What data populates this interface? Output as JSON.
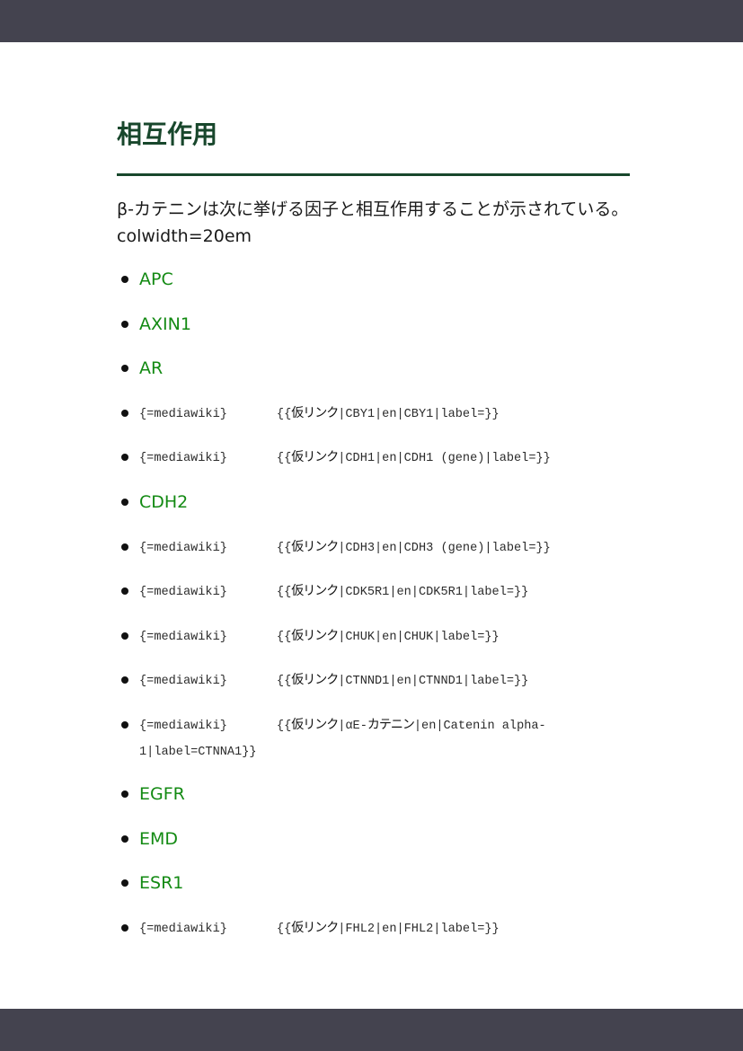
{
  "section": {
    "title": "相互作用",
    "intro": "β-カテニンは次に挙げる因子と相互作用することが示されている。colwidth=20em"
  },
  "interactors": [
    {
      "kind": "link",
      "text": "APC"
    },
    {
      "kind": "link",
      "text": "AXIN1"
    },
    {
      "kind": "link",
      "text": "AR"
    },
    {
      "kind": "code",
      "prefix": "{=mediawiki}",
      "open": "{{",
      "template": "仮リンク",
      "args": "|CBY1|en|CBY1|label=}}"
    },
    {
      "kind": "code",
      "prefix": "{=mediawiki}",
      "open": "{{",
      "template": "仮リンク",
      "args": "|CDH1|en|CDH1 (gene)|label=}}"
    },
    {
      "kind": "link",
      "text": "CDH2"
    },
    {
      "kind": "code",
      "prefix": "{=mediawiki}",
      "open": "{{",
      "template": "仮リンク",
      "args": "|CDH3|en|CDH3 (gene)|label=}}"
    },
    {
      "kind": "code",
      "prefix": "{=mediawiki}",
      "open": "{{",
      "template": "仮リンク",
      "args": "|CDK5R1|en|CDK5R1|label=}}"
    },
    {
      "kind": "code",
      "prefix": "{=mediawiki}",
      "open": "{{",
      "template": "仮リンク",
      "args": "|CHUK|en|CHUK|label=}}"
    },
    {
      "kind": "code",
      "prefix": "{=mediawiki}",
      "open": "{{",
      "template": "仮リンク",
      "args": "|CTNND1|en|CTNND1|label=}}"
    },
    {
      "kind": "code",
      "prefix": "{=mediawiki}",
      "open": "{{",
      "template": "仮リンク",
      "args_a": "|αE-",
      "jp_b": "カテニン",
      "args": "|en|Catenin alpha-1|label=CTNNA1}}"
    },
    {
      "kind": "link",
      "text": "EGFR"
    },
    {
      "kind": "link",
      "text": "EMD"
    },
    {
      "kind": "link",
      "text": "ESR1"
    },
    {
      "kind": "code",
      "prefix": "{=mediawiki}",
      "open": "{{",
      "template": "仮リンク",
      "args": "|FHL2|en|FHL2|label=}}"
    }
  ]
}
